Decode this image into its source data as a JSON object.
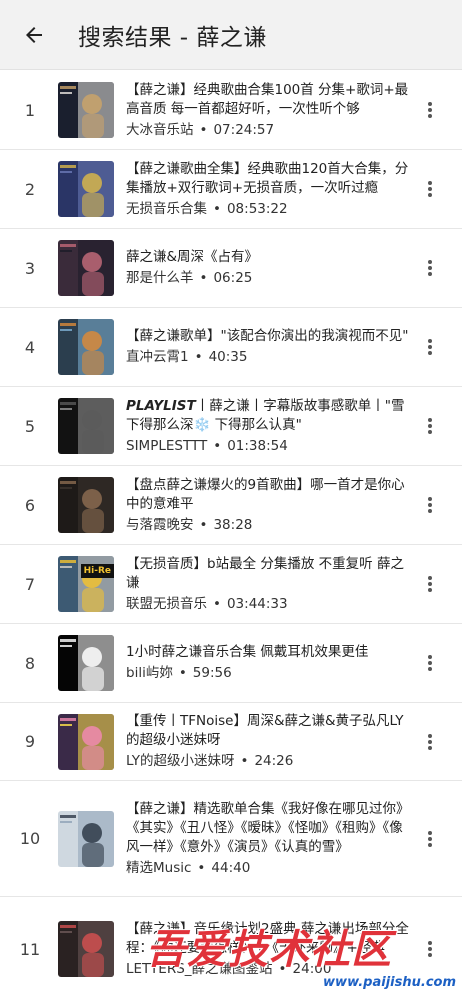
{
  "header": {
    "title": "搜索结果 - 薛之谦"
  },
  "results": [
    {
      "index": "1",
      "title": "【薛之谦】经典歌曲合集100首 分集+歌词+最高音质 每一首都超好听，一次性听个够",
      "channel": "大冰音乐站",
      "duration": "07:24:57",
      "colors": [
        "#1a1f2e",
        "#c9a36a",
        "#e8e3df"
      ]
    },
    {
      "index": "2",
      "title": "【薛之谦歌曲全集】经典歌曲120首大合集，分集播放+双行歌词+无损音质，一次听过瘾",
      "channel": "无损音乐合集",
      "duration": "08:53:22",
      "colors": [
        "#2a3566",
        "#d7b54a",
        "#6b7bb8"
      ]
    },
    {
      "index": "3",
      "title": "薛之谦&周深《占有》",
      "channel": "那是什么羊",
      "duration": "06:25",
      "colors": [
        "#3a2b3a",
        "#c06878",
        "#1c1c28"
      ]
    },
    {
      "index": "4",
      "title": "【薛之谦歌单】\"该配合你演出的我演视而不见\"",
      "channel": "直冲云霄1",
      "duration": "40:35",
      "colors": [
        "#2b3e4e",
        "#d98a3a",
        "#7fb2d6"
      ]
    },
    {
      "index": "5",
      "title_prefix": "PLAYLIST",
      "title": "丨薛之谦丨字幕版故事感歌单丨\"雪下得那么深❄️ 下得那么认真\"",
      "channel": "SIMPLESTTT",
      "duration": "01:38:54",
      "colors": [
        "#121212",
        "#5a5a5a",
        "#9a9a9a"
      ]
    },
    {
      "index": "6",
      "title": "【盘点薛之谦爆火的9首歌曲】哪一首才是你心中的意难平",
      "channel": "与落霞晚安",
      "duration": "38:28",
      "colors": [
        "#1e1a18",
        "#8a6a50",
        "#3c3430"
      ]
    },
    {
      "index": "7",
      "title": "【无损音质】b站最全 分集播放 不重复听 薛之谦",
      "channel": "联盟无损音乐",
      "duration": "03:44:33",
      "colors": [
        "#3d5a73",
        "#f2c230",
        "#d8d2c8"
      ],
      "thumb_text": "Hi-Re"
    },
    {
      "index": "8",
      "title": "1小时薛之谦音乐合集 佩戴耳机效果更佳",
      "channel": "bili屿妳",
      "duration": "59:56",
      "colors": [
        "#050505",
        "#ffffff",
        "#ffffff"
      ]
    },
    {
      "index": "9",
      "title": "【重传丨TFNoise】周深&薛之谦&黄子弘凡LY的超级小迷妹呀",
      "channel": "LY的超级小迷妹呀",
      "duration": "24:26",
      "colors": [
        "#3a2a48",
        "#f08ab0",
        "#ffe24a"
      ]
    },
    {
      "index": "10",
      "title": "【薛之谦】精选歌单合集《我好像在哪见过你》《其实》《丑八怪》《暧昧》《怪咖》《租购》《像风一样》《意外》《演员》《认真的雪》",
      "channel": "精选Music",
      "duration": "44:40",
      "colors": [
        "#cfd8e0",
        "#2e3a48",
        "#8ea2b6"
      ]
    },
    {
      "index": "11",
      "title": "【薛之谦】音乐缘计划2盛典 薛之谦出场部分全程：《你还要我怎样》+《天外来物》+经典",
      "channel": "LETTERS_薛之谦图鉴站",
      "duration": "24:00",
      "colors": [
        "#2a2222",
        "#d05050",
        "#6e5a5a"
      ]
    }
  ],
  "watermark": {
    "text": "吾爱技术社区",
    "url": "www.paijishu.com"
  },
  "theme": {
    "header_bg": "#f2f2f2",
    "divider": "#e6e6e6",
    "watermark_red": "#e0323a",
    "watermark_blue": "#1c60c4"
  }
}
